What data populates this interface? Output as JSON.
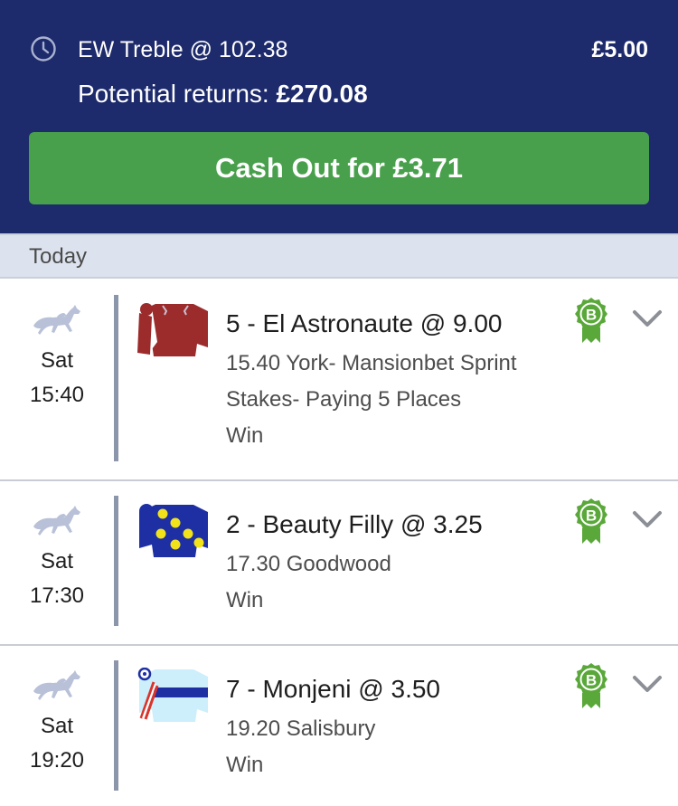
{
  "header": {
    "bet_type": "EW Treble @ 102.38",
    "stake": "£5.00",
    "returns_label": "Potential returns: ",
    "returns_value": "£270.08",
    "cash_out_label": "Cash Out for £3.71"
  },
  "day_label": "Today",
  "legs": [
    {
      "day": "Sat",
      "time": "15:40",
      "selection": "5 - El Astronaute @ 9.00",
      "race_line1": "15.40 York- Mansionbet Sprint",
      "race_line2": "Stakes- Paying 5 Places",
      "market": "Win",
      "badge": "B"
    },
    {
      "day": "Sat",
      "time": "17:30",
      "selection": "2 - Beauty Filly @ 3.25",
      "race_line1": "17.30 Goodwood",
      "race_line2": "",
      "market": "Win",
      "badge": "B"
    },
    {
      "day": "Sat",
      "time": "19:20",
      "selection": "7 - Monjeni @ 3.50",
      "race_line1": "19.20 Salisbury",
      "race_line2": "",
      "market": "Win",
      "badge": "B"
    }
  ],
  "colors": {
    "header_bg": "#1d2a6b",
    "cash_out_green": "#49a04c",
    "badge_green": "#5aa83a",
    "day_bar": "#dde3ee"
  },
  "icons": {
    "clock": "clock-icon",
    "sport": "horse-racing-icon",
    "badge": "best-odds-guaranteed-badge-icon",
    "expand": "chevron-down-icon"
  }
}
